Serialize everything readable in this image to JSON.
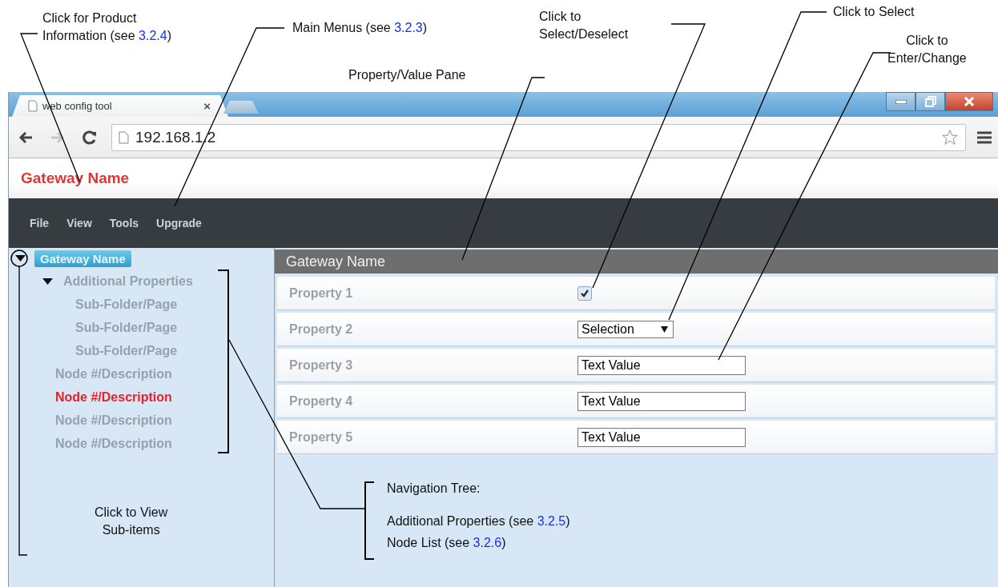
{
  "callouts": [
    {
      "lines": [
        [
          {
            "kind": "text",
            "text": "Click for Product"
          }
        ],
        [
          {
            "kind": "text",
            "text": "Information (see "
          },
          {
            "kind": "link",
            "text": "3.2.4"
          },
          {
            "kind": "text",
            "text": ")"
          }
        ]
      ]
    },
    {
      "lines": [
        [
          {
            "kind": "text",
            "text": "Main Menus (see "
          },
          {
            "kind": "link",
            "text": "3.2.3"
          },
          {
            "kind": "text",
            "text": ")"
          }
        ]
      ]
    },
    {
      "lines": [
        [
          {
            "kind": "text",
            "text": "Click to"
          }
        ],
        [
          {
            "kind": "text",
            "text": "Select/Deselect"
          }
        ]
      ]
    },
    {
      "lines": [
        [
          {
            "kind": "text",
            "text": "Click to Select"
          }
        ]
      ]
    },
    {
      "lines": [
        [
          {
            "kind": "text",
            "text": "Click to"
          }
        ],
        [
          {
            "kind": "text",
            "text": "Enter/Change"
          }
        ]
      ]
    },
    {
      "lines": [
        [
          {
            "kind": "text",
            "text": "Property/Value Pane"
          }
        ]
      ]
    },
    {
      "lines": [
        [
          {
            "kind": "text",
            "text": "Click to View"
          }
        ],
        [
          {
            "kind": "text",
            "text": "Sub-items"
          }
        ]
      ]
    },
    {
      "lines": [
        [
          {
            "kind": "text",
            "text": "Navigation Tree:"
          }
        ],
        [
          {
            "kind": "text",
            "text": "Additional Properties (see "
          },
          {
            "kind": "link",
            "text": "3.2.5"
          },
          {
            "kind": "text",
            "text": ")"
          }
        ],
        [
          {
            "kind": "text",
            "text": "Node List (see "
          },
          {
            "kind": "link",
            "text": "3.2.6"
          },
          {
            "kind": "text",
            "text": ")"
          }
        ]
      ]
    }
  ],
  "browser": {
    "tab": {
      "title": "web config tool",
      "close": "×"
    },
    "url": "192.168.1.2",
    "forward_disabled": true
  },
  "page": {
    "title": "Gateway Name",
    "menus": [
      "File",
      "View",
      "Tools",
      "Upgrade"
    ],
    "tree": [
      {
        "label": "Gateway Name",
        "selected": true,
        "alert": false,
        "expanded": true,
        "children": [
          {
            "label": "Additional Properties",
            "selected": false,
            "alert": false,
            "expanded": true,
            "children": [
              {
                "label": "Sub-Folder/Page",
                "selected": false,
                "alert": false
              },
              {
                "label": "Sub-Folder/Page",
                "selected": false,
                "alert": false
              },
              {
                "label": "Sub-Folder/Page",
                "selected": false,
                "alert": false
              }
            ]
          },
          {
            "label": "Node #/Description",
            "selected": false,
            "alert": false
          },
          {
            "label": "Node #/Description",
            "selected": false,
            "alert": true
          },
          {
            "label": "Node #/Description",
            "selected": false,
            "alert": false
          },
          {
            "label": "Node #/Description",
            "selected": false,
            "alert": false
          }
        ]
      }
    ],
    "pane": {
      "title": "Gateway Name",
      "properties": [
        {
          "label": "Property 1",
          "kind": "checkbox",
          "checked": true
        },
        {
          "label": "Property 2",
          "kind": "select",
          "value": "Selection"
        },
        {
          "label": "Property 3",
          "kind": "text",
          "value": "Text Value"
        },
        {
          "label": "Property 4",
          "kind": "text",
          "value": "Text Value"
        },
        {
          "label": "Property 5",
          "kind": "text",
          "value": "Text Value"
        }
      ]
    }
  }
}
